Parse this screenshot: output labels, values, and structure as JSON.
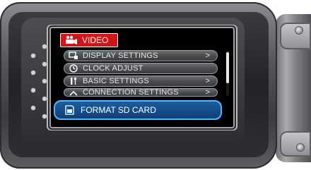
{
  "menu": {
    "tab": {
      "label": "VIDEO",
      "icon": "video-camera-icon"
    },
    "items": [
      {
        "label": "DISPLAY SETTINGS",
        "icon": "display-settings-icon",
        "arrow": ">"
      },
      {
        "label": "CLOCK ADJUST",
        "icon": "clock-icon",
        "arrow": ""
      },
      {
        "label": "BASIC SETTINGS",
        "icon": "wrench-screwdriver-icon",
        "arrow": ">"
      },
      {
        "label": "CONNECTION SETTINGS",
        "icon": "connection-icon",
        "arrow": ">"
      }
    ],
    "selected": {
      "label": "FORMAT SD CARD",
      "icon": "sd-card-icon"
    }
  },
  "colors": {
    "tab_red": "#d21416",
    "selection_blue": "#0e4077",
    "selection_border": "#53b6ff"
  }
}
